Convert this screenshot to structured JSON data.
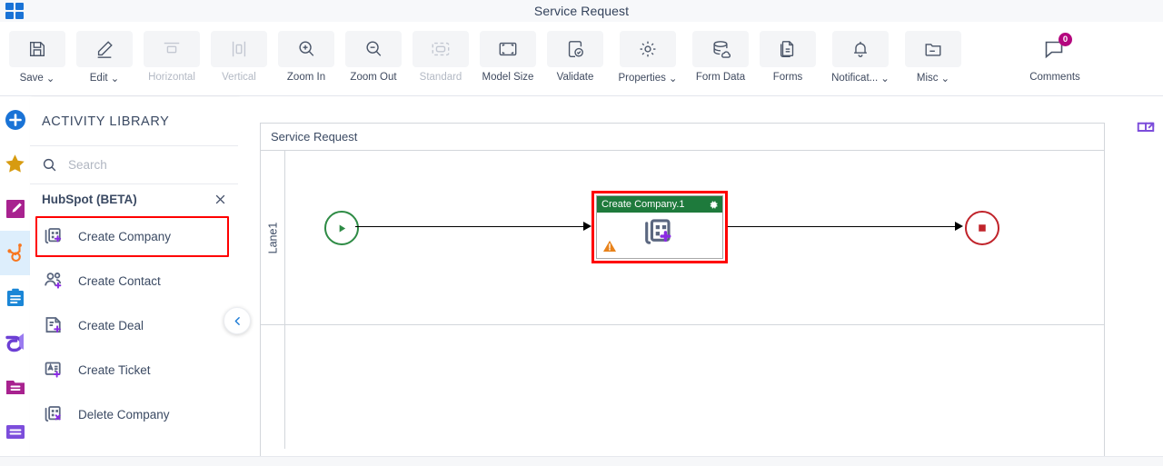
{
  "window": {
    "title": "Service Request",
    "app_logo_icon": "grid-apps-icon"
  },
  "toolbar": {
    "items": [
      {
        "label": "Save",
        "icon": "save-icon",
        "caret": "⌄",
        "has_caret": true,
        "disabled": false
      },
      {
        "label": "Edit",
        "icon": "pencil-icon",
        "caret": "⌄",
        "has_caret": true,
        "disabled": false
      },
      {
        "label": "Horizontal",
        "icon": "horizontal-align-icon",
        "caret": "",
        "has_caret": false,
        "disabled": true
      },
      {
        "label": "Vertical",
        "icon": "vertical-align-icon",
        "caret": "",
        "has_caret": false,
        "disabled": true
      },
      {
        "label": "Zoom In",
        "icon": "zoom-in-icon",
        "caret": "",
        "has_caret": false,
        "disabled": false
      },
      {
        "label": "Zoom Out",
        "icon": "zoom-out-icon",
        "caret": "",
        "has_caret": false,
        "disabled": false
      },
      {
        "label": "Standard",
        "icon": "standard-size-icon",
        "caret": "",
        "has_caret": false,
        "disabled": true
      },
      {
        "label": "Model Size",
        "icon": "model-size-icon",
        "caret": "",
        "has_caret": false,
        "disabled": false
      },
      {
        "label": "Validate",
        "icon": "validate-icon",
        "caret": "",
        "has_caret": false,
        "disabled": false
      },
      {
        "label": "Properties",
        "icon": "gear-icon",
        "caret": "⌄",
        "has_caret": true,
        "disabled": false
      },
      {
        "label": "Form Data",
        "icon": "database-icon",
        "caret": "",
        "has_caret": false,
        "disabled": false
      },
      {
        "label": "Forms",
        "icon": "forms-icon",
        "caret": "",
        "has_caret": false,
        "disabled": false
      },
      {
        "label": "Notificat...",
        "icon": "bell-icon",
        "caret": "⌄",
        "has_caret": true,
        "disabled": false
      },
      {
        "label": "Misc",
        "icon": "folder-icon",
        "caret": "⌄",
        "has_caret": true,
        "disabled": false
      }
    ],
    "comments": {
      "label": "Comments",
      "icon": "comment-icon",
      "badge_count": "0",
      "badge_color": "#b4077e"
    }
  },
  "rail": {
    "items": [
      {
        "name": "add-icon",
        "tooltip": "Add",
        "active": false
      },
      {
        "name": "favorites-icon",
        "tooltip": "Favorites",
        "active": false
      },
      {
        "name": "edit-forms-icon",
        "tooltip": "Edit",
        "active": false
      },
      {
        "name": "hubspot-icon",
        "tooltip": "HubSpot",
        "active": true
      },
      {
        "name": "clipboard-icon",
        "tooltip": "Tasks",
        "active": false
      },
      {
        "name": "appian-icon",
        "tooltip": "Integrations",
        "active": false
      },
      {
        "name": "folder-icon",
        "tooltip": "Library",
        "active": false
      },
      {
        "name": "list-icon",
        "tooltip": "List",
        "active": false
      }
    ]
  },
  "panel": {
    "title": "ACTIVITY LIBRARY",
    "search": {
      "placeholder": "Search",
      "value": "",
      "icon": "search-icon"
    },
    "group": {
      "label": "HubSpot (BETA)",
      "close_icon": "close-icon"
    },
    "activities": [
      {
        "label": "Create Company",
        "icon": "create-company-icon",
        "selected": true
      },
      {
        "label": "Create Contact",
        "icon": "create-contact-icon",
        "selected": false
      },
      {
        "label": "Create Deal",
        "icon": "create-deal-icon",
        "selected": false
      },
      {
        "label": "Create Ticket",
        "icon": "create-ticket-icon",
        "selected": false
      },
      {
        "label": "Delete Company",
        "icon": "delete-company-icon",
        "selected": false
      }
    ],
    "collapse_icon": "chevron-left-icon"
  },
  "canvas": {
    "expand_icon": "expand-icon",
    "pool_title": "Service Request",
    "lanes": [
      {
        "label": "Lane1"
      },
      {
        "label": ""
      }
    ],
    "nodes": {
      "start": {
        "name": "start-event",
        "icon": "play-icon",
        "color": "#2e8b45"
      },
      "task": {
        "title": "Create Company.1",
        "header_color": "#1e7a3c",
        "selection_color": "#ff0000",
        "gear_icon": "gear-icon",
        "warning_icon": "warning-icon",
        "glyph_icon": "create-company-icon"
      },
      "end": {
        "name": "end-event",
        "icon": "stop-icon",
        "color": "#c0232a"
      }
    }
  }
}
